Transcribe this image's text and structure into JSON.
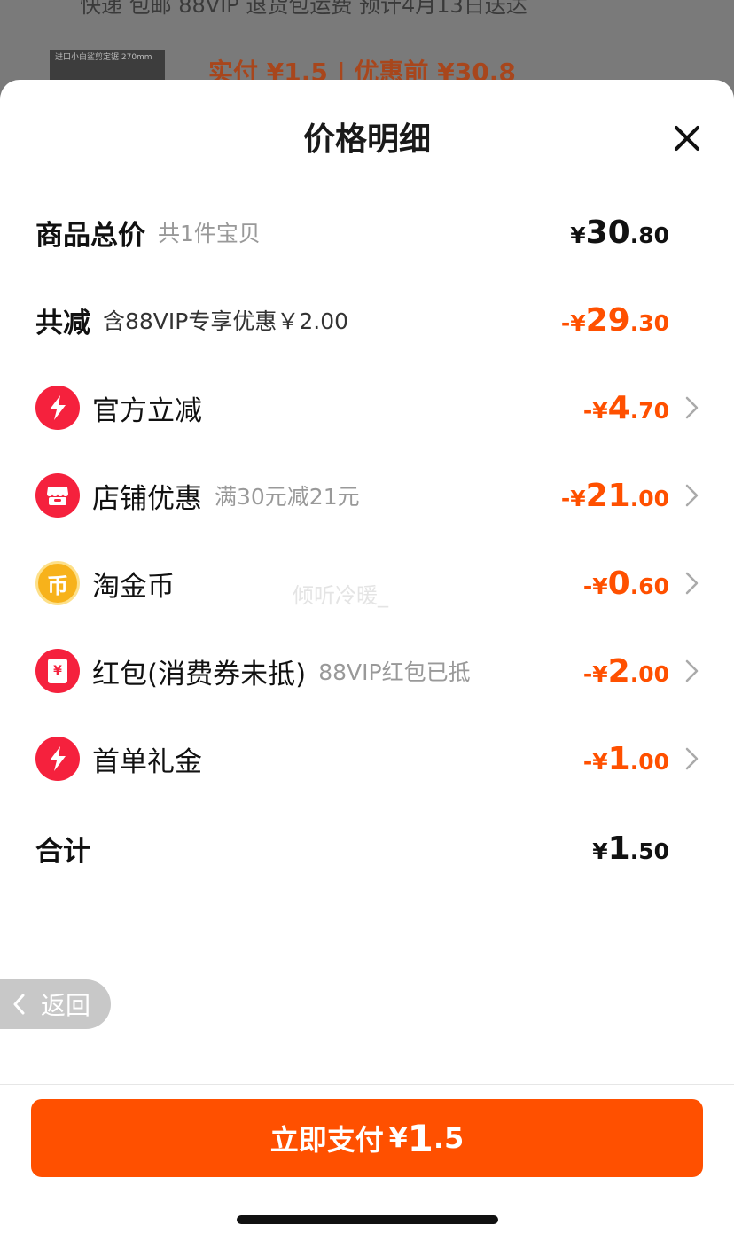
{
  "background": {
    "line": "快递 包邮 88VIP 退货包运费 预计4月13日送达",
    "thumb_text": "进口小白鲨剪定锯 270mm",
    "price_text": "实付 ¥1.5 | 优惠前 ¥30.8"
  },
  "sheet": {
    "title": "价格明细"
  },
  "rows": [
    {
      "label": "商品总价",
      "sub": "共1件宝贝",
      "prefix": "¥",
      "int": "30",
      "dec": ".80",
      "color": "black"
    },
    {
      "label": "共减",
      "sub": "含88VIP专享优惠￥2.00",
      "prefix": "-¥",
      "int": "29",
      "dec": ".30",
      "color": "orange"
    },
    {
      "label": "官方立减",
      "sub": "",
      "prefix": "-¥",
      "int": "4",
      "dec": ".70",
      "icon": "lightning-icon"
    },
    {
      "label": "店铺优惠",
      "sub": "满30元减21元",
      "prefix": "-¥",
      "int": "21",
      "dec": ".00",
      "icon": "shop-icon"
    },
    {
      "label": "淘金币",
      "sub": "",
      "prefix": "-¥",
      "int": "0",
      "dec": ".60",
      "icon": "coin-icon",
      "icon_char": "币"
    },
    {
      "label": "红包(消费券未抵)",
      "sub": "88VIP红包已抵",
      "prefix": "-¥",
      "int": "2",
      "dec": ".00",
      "icon": "red-envelope-icon",
      "icon_char": "¥"
    },
    {
      "label": "首单礼金",
      "sub": "",
      "prefix": "-¥",
      "int": "1",
      "dec": ".00",
      "icon": "lightning-icon"
    },
    {
      "label": "合计",
      "sub": "",
      "prefix": "¥",
      "int": "1",
      "dec": ".50",
      "color": "black"
    }
  ],
  "watermark": "倾听冷暖_",
  "back": {
    "label": "返回"
  },
  "pay": {
    "label": "立即支付",
    "prefix": "¥",
    "int": "1",
    "dec": ".5"
  },
  "colors": {
    "accent": "#ff5000",
    "icon_red": "#f5213d",
    "coin_gold": "#f7b21b"
  }
}
